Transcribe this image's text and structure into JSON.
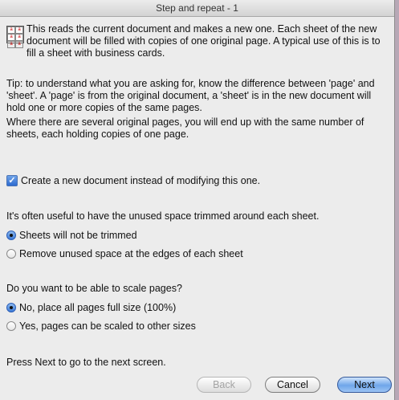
{
  "window": {
    "title": "Step and repeat - 1"
  },
  "icon": {
    "name": "step-and-repeat-icon",
    "glyph": "a"
  },
  "intro": "This reads the current document and makes a new one. Each sheet of the new document will be filled with copies of one original page. A typical use of this is to fill a sheet with business cards.",
  "tip": "Tip: to understand what you are asking for, know the difference between 'page' and 'sheet'. A 'page' is from the original document, a 'sheet' is in the new document will hold one or more copies of the same pages.",
  "several_pages": "Where there are several original pages, you will end up with the same number of sheets, each holding copies of one page.",
  "new_document_checkbox": {
    "label": "Create a new document instead of modifying this one.",
    "checked": true
  },
  "trim": {
    "question": "It's often useful to have the unused space trimmed around each sheet.",
    "options": [
      {
        "label": "Sheets will not be trimmed",
        "selected": true
      },
      {
        "label": "Remove unused space at the edges of each sheet",
        "selected": false
      }
    ]
  },
  "scale": {
    "question": "Do you want to be able to scale pages?",
    "options": [
      {
        "label": "No, place all pages full size (100%)",
        "selected": true
      },
      {
        "label": "Yes, pages can be scaled to other sizes",
        "selected": false
      }
    ]
  },
  "footer_hint": "Press Next to go to the next screen.",
  "buttons": {
    "back": "Back",
    "cancel": "Cancel",
    "next": "Next"
  },
  "colors": {
    "background": "#b7a8b6",
    "window": "#ececec",
    "accent": "#3d7ad6"
  }
}
